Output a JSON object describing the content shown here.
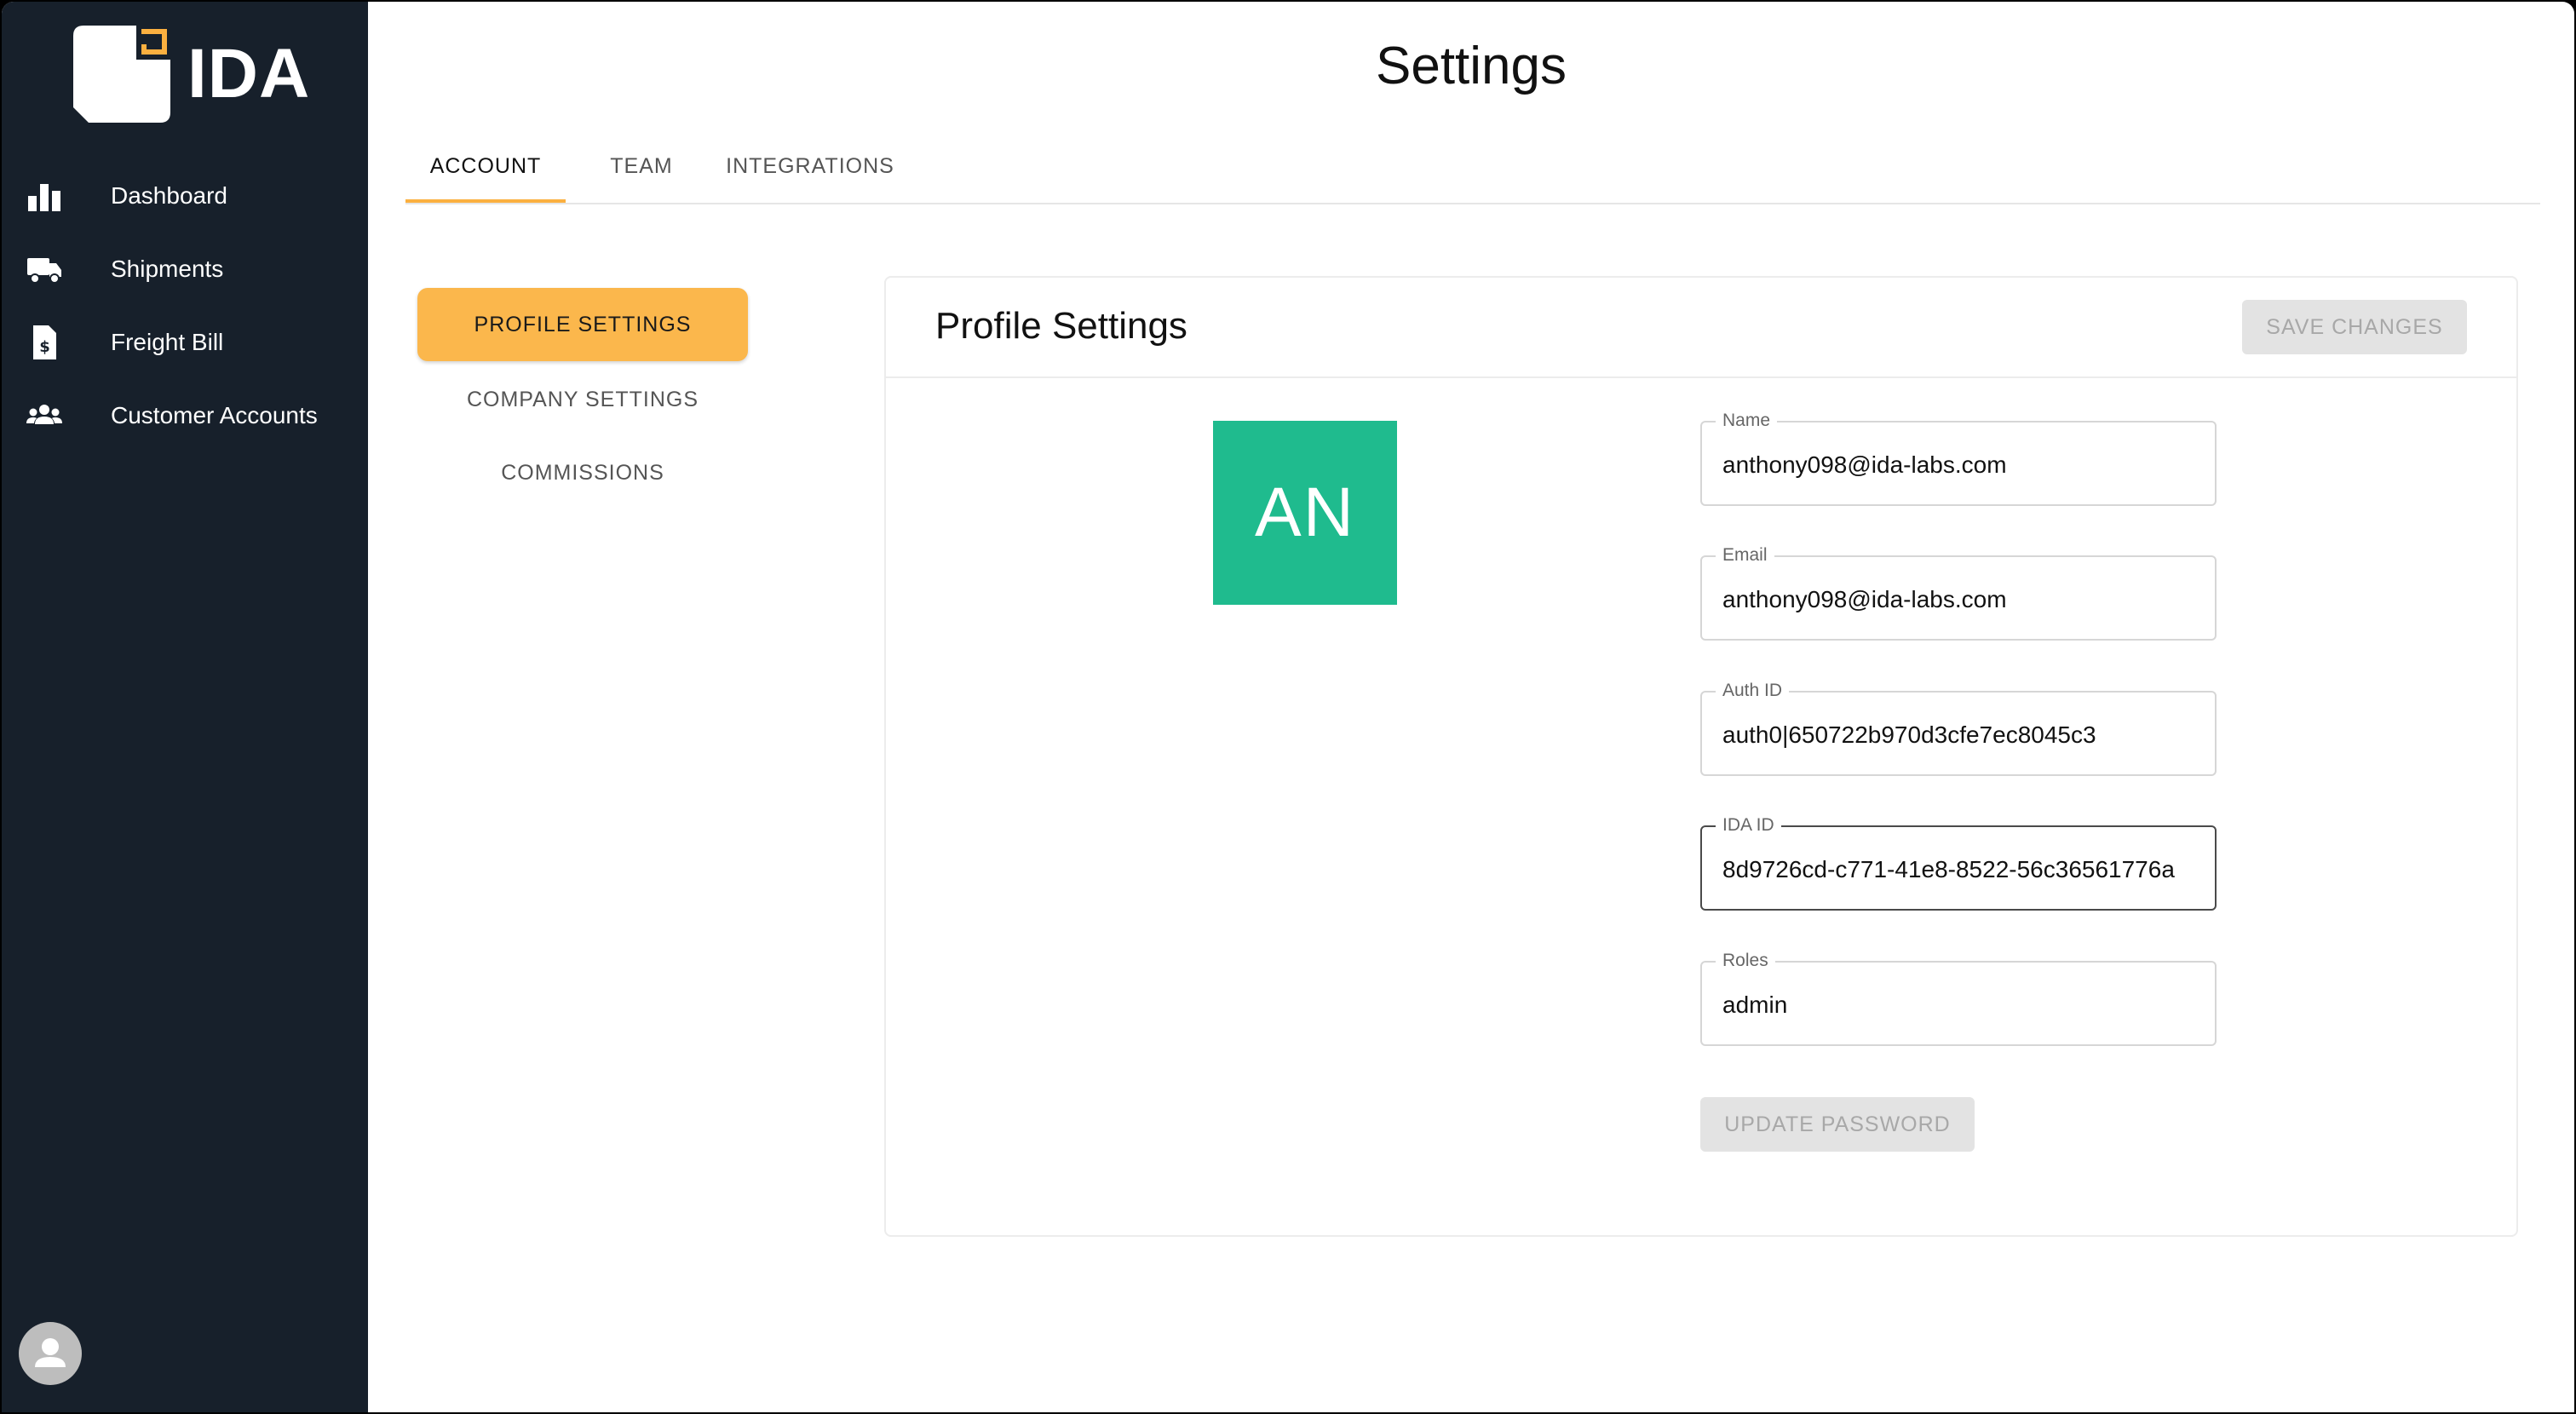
{
  "brand": {
    "logo_text": "IDA",
    "accent_color": "#fbb040",
    "sidebar_color": "#17202b"
  },
  "sidebar": {
    "items": [
      {
        "label": "Dashboard",
        "icon": "bar-chart-icon"
      },
      {
        "label": "Shipments",
        "icon": "truck-icon"
      },
      {
        "label": "Freight Bill",
        "icon": "invoice-dollar-icon"
      },
      {
        "label": "Customer Accounts",
        "icon": "people-group-icon"
      }
    ],
    "user_avatar_icon": "user-icon"
  },
  "header": {
    "title": "Settings"
  },
  "tabs": [
    {
      "label": "ACCOUNT",
      "active": true
    },
    {
      "label": "TEAM",
      "active": false
    },
    {
      "label": "INTEGRATIONS",
      "active": false
    }
  ],
  "subnav": [
    {
      "label": "PROFILE SETTINGS",
      "active": true
    },
    {
      "label": "COMPANY SETTINGS",
      "active": false
    },
    {
      "label": "COMMISSIONS",
      "active": false
    }
  ],
  "profile": {
    "title": "Profile Settings",
    "save_label": "SAVE CHANGES",
    "avatar_initials": "AN",
    "avatar_color": "#1fbb8e",
    "fields": {
      "name": {
        "label": "Name",
        "value": "anthony098@ida-labs.com"
      },
      "email": {
        "label": "Email",
        "value": "anthony098@ida-labs.com"
      },
      "auth_id": {
        "label": "Auth ID",
        "value": "auth0|650722b970d3cfe7ec8045c3"
      },
      "ida_id": {
        "label": "IDA ID",
        "value": "8d9726cd-c771-41e8-8522-56c36561776a"
      },
      "roles": {
        "label": "Roles",
        "value": "admin"
      }
    },
    "update_password_label": "UPDATE PASSWORD"
  }
}
